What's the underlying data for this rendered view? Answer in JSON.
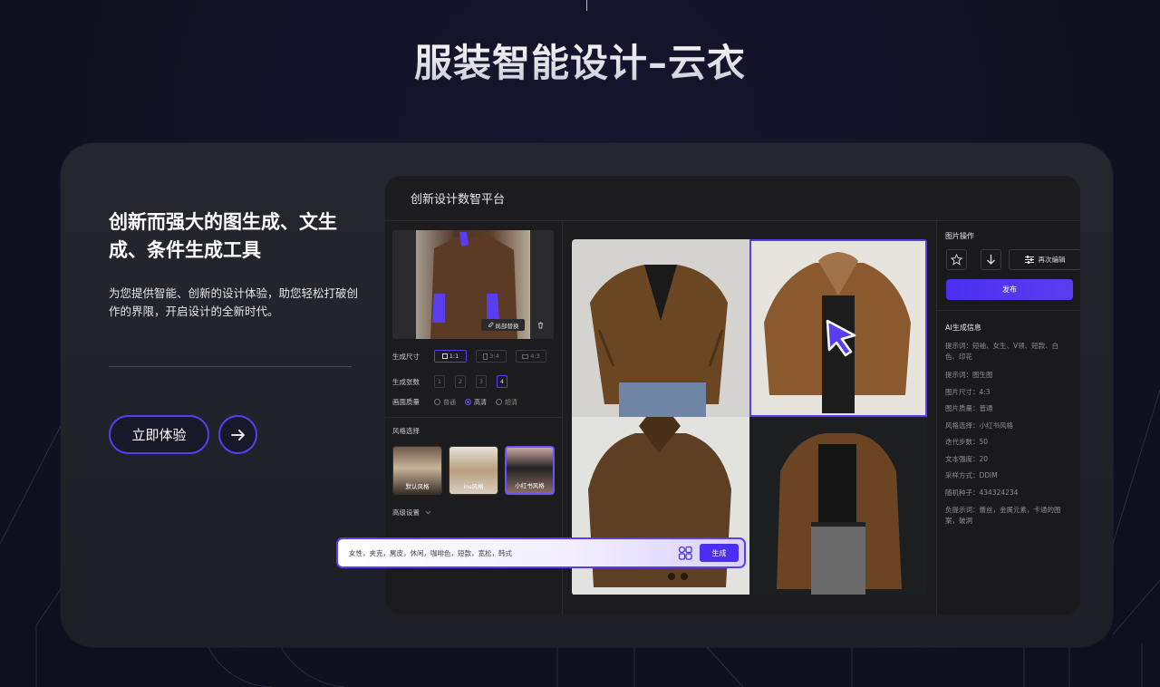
{
  "page": {
    "title": "服装智能设计–云衣"
  },
  "intro": {
    "headline": "创新而强大的图生成、文生成、条件生成工具",
    "description": "为您提供智能、创新的设计体验，助您轻松打破创作的界限，开启设计的全新时代。",
    "cta_label": "立即体验"
  },
  "app": {
    "title": "创新设计数智平台",
    "left_panel": {
      "local_replace_label": "局部替换",
      "size": {
        "label": "生成尺寸",
        "options": [
          "1:1",
          "3:4",
          "4:3"
        ],
        "selected": "1:1"
      },
      "count": {
        "label": "生成张数",
        "options": [
          "1",
          "2",
          "3",
          "4"
        ],
        "selected": "4"
      },
      "quality": {
        "label": "画面质量",
        "options": [
          "普通",
          "高清",
          "超清"
        ],
        "selected": "高清"
      },
      "style_section_label": "风格选择",
      "styles": [
        {
          "label": "默认风格",
          "selected": false
        },
        {
          "label": "ins风格",
          "selected": false
        },
        {
          "label": "小红书风格",
          "selected": true
        }
      ],
      "advanced_label": "高级设置"
    },
    "prompt_bar": {
      "text": "女性，夹克，麂皮，休闲，咖啡色，短款，宽松，韩式",
      "generate_label": "生成"
    },
    "right_panel": {
      "image_ops_title": "图片操作",
      "re_edit_label": "再次编辑",
      "publish_label": "发布",
      "ai_info_title": "AI生成信息",
      "info": [
        "提示词：短袖、女生、V领、短款、白色、印花",
        "提示词：图生图",
        "图片尺寸：4:3",
        "图片质量：普通",
        "风格选择：小红书风格",
        "迭代步数：50",
        "文本强度：20",
        "采样方式：DDIM",
        "随机种子：434324234",
        "负提示词：蕾丝，金属元素，卡通的图案，破洞"
      ]
    }
  },
  "colors": {
    "accent": "#5b3df0",
    "card": "#24242c",
    "panel": "#1c1c1e"
  },
  "icons": [
    "arrow-right-icon",
    "pencil-icon",
    "trash-icon",
    "star-icon",
    "download-icon",
    "sliders-icon",
    "chevron-down-icon",
    "style-icon",
    "cursor-icon"
  ]
}
